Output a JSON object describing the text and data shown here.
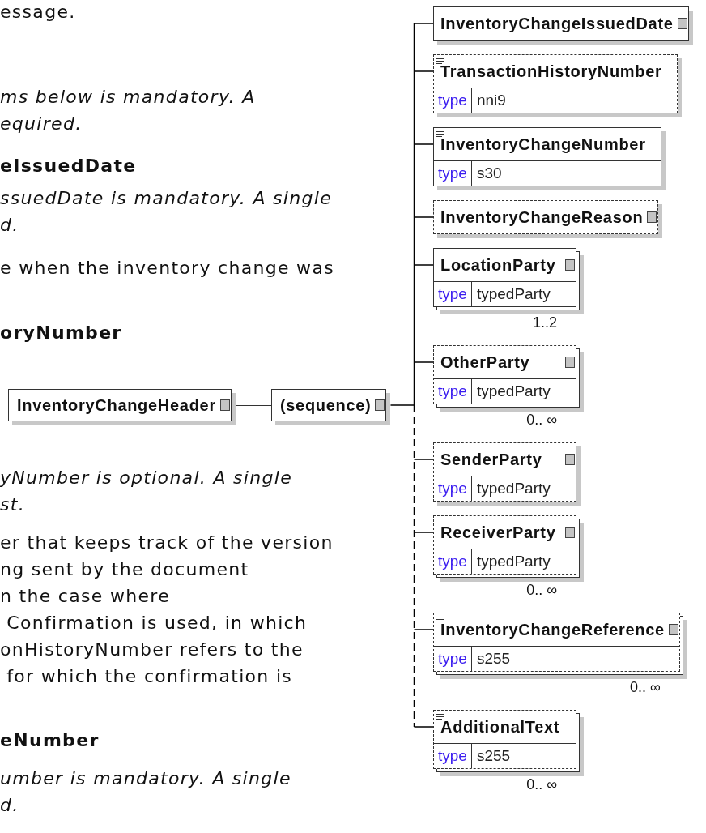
{
  "text_above_diagram": [
    {
      "kind": "body",
      "lines": [
        "essage."
      ]
    },
    {
      "kind": "italic",
      "lines": [
        "ms below is mandatory. A",
        "equired."
      ]
    },
    {
      "kind": "heading",
      "lines": [
        "eIssuedDate"
      ]
    },
    {
      "kind": "italic",
      "lines": [
        "ssuedDate is mandatory. A single",
        "d."
      ]
    },
    {
      "kind": "body",
      "lines": [
        "e when the inventory change was"
      ]
    },
    {
      "kind": "heading",
      "lines": [
        "oryNumber"
      ]
    }
  ],
  "diagram": {
    "root": {
      "name": "InventoryChangeHeader",
      "expandable": true
    },
    "compositor": {
      "label": "(sequence)",
      "expandable": true
    },
    "children": [
      {
        "name": "InventoryChangeIssuedDate",
        "optional": false,
        "documented": false,
        "expandable": true,
        "multiple": false
      },
      {
        "name": "TransactionHistoryNumber",
        "optional": true,
        "documented": true,
        "expandable": false,
        "multiple": false,
        "type_label": "type",
        "type": "nni9"
      },
      {
        "name": "InventoryChangeNumber",
        "optional": false,
        "documented": true,
        "expandable": false,
        "multiple": false,
        "type_label": "type",
        "type": "s30"
      },
      {
        "name": "InventoryChangeReason",
        "optional": true,
        "documented": false,
        "expandable": true,
        "multiple": false
      },
      {
        "name": "LocationParty",
        "optional": false,
        "documented": false,
        "expandable": true,
        "multiple": true,
        "type_label": "type",
        "type": "typedParty",
        "occurrence": "1..2"
      },
      {
        "name": "OtherParty",
        "optional": true,
        "documented": false,
        "expandable": true,
        "multiple": true,
        "type_label": "type",
        "type": "typedParty",
        "occurrence": "0.. ∞"
      },
      {
        "name": "SenderParty",
        "optional": true,
        "documented": false,
        "expandable": true,
        "multiple": false,
        "type_label": "type",
        "type": "typedParty"
      },
      {
        "name": "ReceiverParty",
        "optional": true,
        "documented": false,
        "expandable": true,
        "multiple": true,
        "type_label": "type",
        "type": "typedParty",
        "occurrence": "0.. ∞"
      },
      {
        "name": "InventoryChangeReference",
        "optional": true,
        "documented": true,
        "expandable": true,
        "multiple": true,
        "type_label": "type",
        "type": "s255",
        "occurrence": "0.. ∞"
      },
      {
        "name": "AdditionalText",
        "optional": true,
        "documented": true,
        "expandable": false,
        "multiple": true,
        "type_label": "type",
        "type": "s255",
        "occurrence": "0.. ∞"
      }
    ]
  },
  "text_below_diagram": [
    {
      "kind": "italic",
      "lines": [
        "yNumber is optional. A single",
        "st."
      ]
    },
    {
      "kind": "body",
      "lines": [
        "er that keeps track of the version",
        "ng sent by the document",
        "n the case where",
        " Confirmation is used, in which",
        "onHistoryNumber refers to the",
        " for which the confirmation is"
      ]
    },
    {
      "kind": "heading",
      "lines": [
        "eNumber"
      ]
    },
    {
      "kind": "italic",
      "lines": [
        "umber is mandatory. A single",
        "d."
      ]
    }
  ]
}
